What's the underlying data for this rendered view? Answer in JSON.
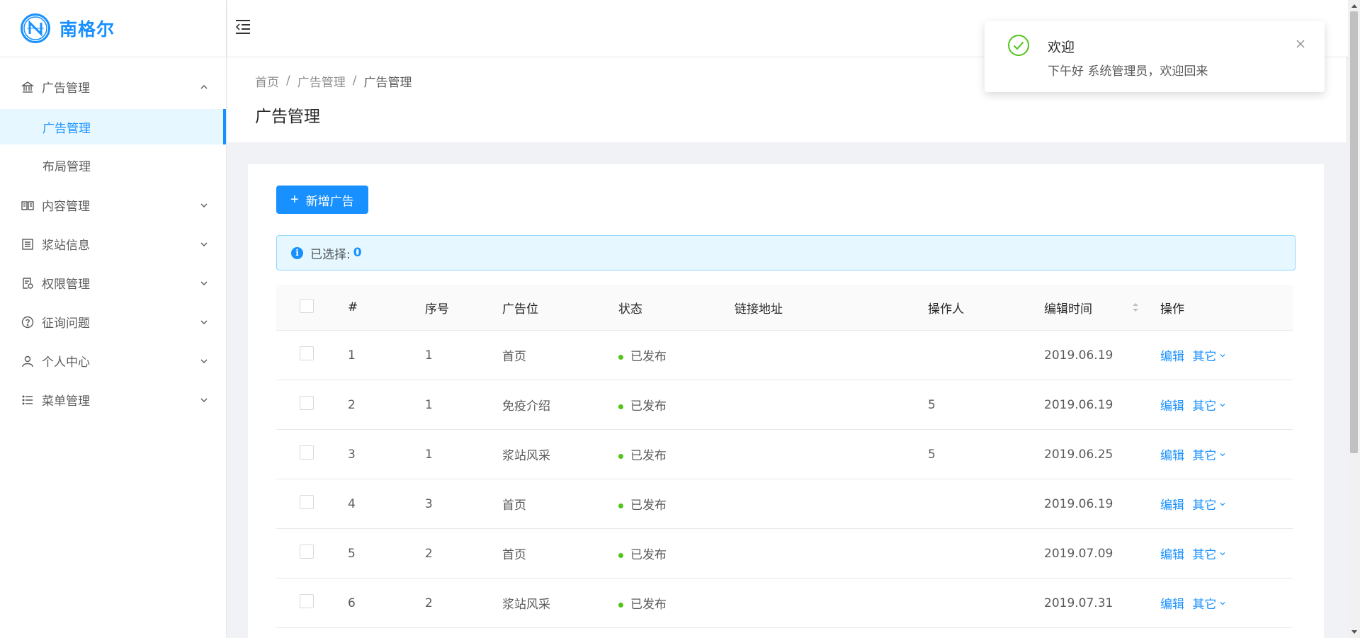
{
  "app": {
    "brand": "南格尔"
  },
  "sidebar": {
    "items": [
      {
        "label": "广告管理",
        "icon": "bank-icon",
        "expanded": true,
        "children": [
          {
            "label": "广告管理",
            "active": true
          },
          {
            "label": "布局管理",
            "active": false
          }
        ]
      },
      {
        "label": "内容管理",
        "icon": "book-icon",
        "expanded": false
      },
      {
        "label": "浆站信息",
        "icon": "profile-icon",
        "expanded": false
      },
      {
        "label": "权限管理",
        "icon": "audit-icon",
        "expanded": false
      },
      {
        "label": "征询问题",
        "icon": "question-circle-icon",
        "expanded": false
      },
      {
        "label": "个人中心",
        "icon": "user-icon",
        "expanded": false
      },
      {
        "label": "菜单管理",
        "icon": "unordered-list-icon",
        "expanded": false
      }
    ]
  },
  "breadcrumb": {
    "items": [
      "首页",
      "广告管理",
      "广告管理"
    ],
    "separator": "/"
  },
  "page": {
    "title": "广告管理"
  },
  "toolbar": {
    "add_label": "新增广告"
  },
  "alert": {
    "selected_label": "已选择:",
    "selected_count": "0"
  },
  "table": {
    "headers": {
      "index": "#",
      "seq": "序号",
      "position": "广告位",
      "status": "状态",
      "link": "链接地址",
      "operator": "操作人",
      "edit_time": "编辑时间",
      "action": "操作"
    },
    "rows": [
      {
        "index": "1",
        "seq": "1",
        "position": "首页",
        "status": "已发布",
        "link": "",
        "operator": "",
        "edit_time": "2019.06.19",
        "edit": "编辑",
        "other": "其它"
      },
      {
        "index": "2",
        "seq": "1",
        "position": "免疫介绍",
        "status": "已发布",
        "link": "",
        "operator": "5",
        "edit_time": "2019.06.19",
        "edit": "编辑",
        "other": "其它"
      },
      {
        "index": "3",
        "seq": "1",
        "position": "浆站风采",
        "status": "已发布",
        "link": "",
        "operator": "5",
        "edit_time": "2019.06.25",
        "edit": "编辑",
        "other": "其它"
      },
      {
        "index": "4",
        "seq": "3",
        "position": "首页",
        "status": "已发布",
        "link": "",
        "operator": "",
        "edit_time": "2019.06.19",
        "edit": "编辑",
        "other": "其它"
      },
      {
        "index": "5",
        "seq": "2",
        "position": "首页",
        "status": "已发布",
        "link": "",
        "operator": "",
        "edit_time": "2019.07.09",
        "edit": "编辑",
        "other": "其它"
      },
      {
        "index": "6",
        "seq": "2",
        "position": "浆站风采",
        "status": "已发布",
        "link": "",
        "operator": "",
        "edit_time": "2019.07.31",
        "edit": "编辑",
        "other": "其它"
      }
    ]
  },
  "notification": {
    "title": "欢迎",
    "description": "下午好 系统管理员，欢迎回来",
    "icon": "check-circle-icon"
  },
  "colors": {
    "primary": "#1890ff",
    "success": "#52c41a"
  }
}
